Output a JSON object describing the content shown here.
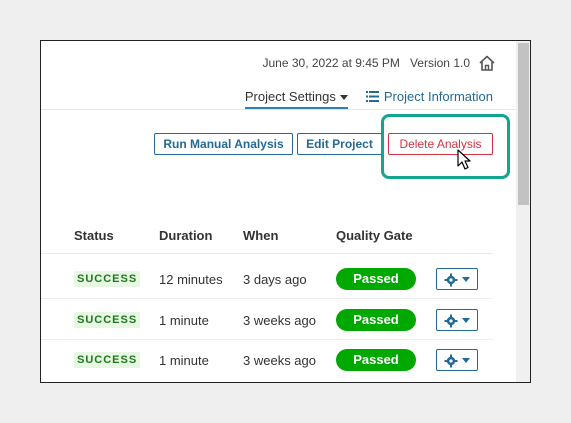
{
  "header": {
    "timestamp": "June 30, 2022 at 9:45 PM",
    "version": "Version 1.0"
  },
  "nav": {
    "settings_label": "Project Settings",
    "info_label": "Project Information"
  },
  "actions": {
    "run_label": "Run Manual Analysis",
    "edit_label": "Edit Project",
    "delete_label": "Delete Analysis"
  },
  "table": {
    "headers": [
      "Status",
      "Duration",
      "When",
      "Quality Gate"
    ],
    "rows": [
      {
        "status": "SUCCESS",
        "duration": "12 minutes",
        "when": "3 days ago",
        "gate": "Passed"
      },
      {
        "status": "SUCCESS",
        "duration": "1 minute",
        "when": "3 weeks ago",
        "gate": "Passed"
      },
      {
        "status": "SUCCESS",
        "duration": "1 minute",
        "when": "3 weeks ago",
        "gate": "Passed"
      }
    ]
  },
  "colors": {
    "accent": "#236a97",
    "danger": "#d4333f",
    "highlight": "#13a58f",
    "passed": "#00a800",
    "success_text": "#1c7a1c"
  },
  "icons": [
    "home-icon",
    "chevron-down-icon",
    "list-icon",
    "gear-icon",
    "pointer-cursor-icon"
  ]
}
